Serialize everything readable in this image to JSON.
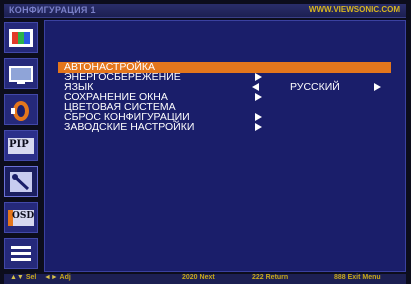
{
  "title": "КОНФИГУРАЦИЯ 1",
  "brand_url": "WWW.VIEWSONIC.COM",
  "colors": {
    "panel": "#1a1e6a",
    "highlight": "#e4761c",
    "accent_yellow": "#d8b61e"
  },
  "sidebar": {
    "items": [
      {
        "name": "picture-icon"
      },
      {
        "name": "screen-icon"
      },
      {
        "name": "audio-icon"
      },
      {
        "label": "PIP"
      },
      {
        "name": "tools-icon"
      },
      {
        "label": "OSD"
      },
      {
        "name": "list-icon"
      }
    ]
  },
  "menu": {
    "items": [
      {
        "label": "АВТОНАСТРОЙКА"
      },
      {
        "label": "ЭНЕРГОСБЕРЕЖЕНИЕ"
      },
      {
        "label": "ЯЗЫК",
        "value": "РУССКИЙ"
      },
      {
        "label": "СОХРАНЕНИЕ ОКНА"
      },
      {
        "label": "ЦВЕТОВАЯ СИСТЕМА"
      },
      {
        "label": "СБРОС КОНФИГУРАЦИИ"
      },
      {
        "label": "ЗАВОДСКИЕ НАСТРОЙКИ"
      }
    ]
  },
  "footer": {
    "hints": [
      {
        "key": "▲▼",
        "text": "Sel"
      },
      {
        "key": "◄►",
        "text": "Adj"
      },
      {
        "key": "",
        "text": "2020 Next"
      },
      {
        "key": "",
        "text": "222 Return"
      },
      {
        "key": "",
        "text": "888 Exit Menu"
      }
    ]
  }
}
